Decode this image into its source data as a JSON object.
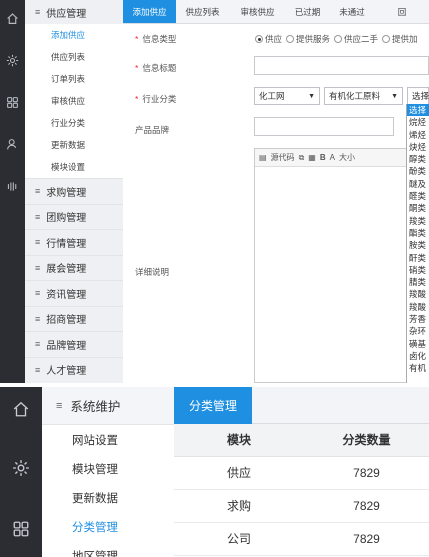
{
  "top": {
    "menu": {
      "title": "供应管理",
      "items": [
        {
          "label": "添加供应",
          "active": true
        },
        {
          "label": "供应列表"
        },
        {
          "label": "订单列表"
        },
        {
          "label": "审核供应"
        },
        {
          "label": "行业分类"
        },
        {
          "label": "更新数据"
        },
        {
          "label": "模块设置"
        }
      ],
      "groups": [
        "求购管理",
        "团购管理",
        "行情管理",
        "展会管理",
        "资讯管理",
        "招商管理",
        "品牌管理",
        "人才管理"
      ]
    },
    "tabs": [
      {
        "label": "添加供应",
        "active": true
      },
      {
        "label": "供应列表"
      },
      {
        "label": "审核供应"
      },
      {
        "label": "已过期"
      },
      {
        "label": "未通过"
      },
      {
        "label": "回"
      }
    ],
    "form": {
      "type_label": "信息类型",
      "type_options": [
        "供应",
        "提供服务",
        "供应二手",
        "提供加"
      ],
      "title_label": "信息标题",
      "category_label": "行业分类",
      "category_selects": [
        "化工网",
        "有机化工原料",
        "选择"
      ],
      "brand_label": "产品品牌",
      "detail_label": "详细说明",
      "editor_toolbar": [
        "源代码",
        "B",
        "大小"
      ]
    },
    "dropdown": [
      "选择",
      "烷烃",
      "烯烃",
      "炔烃",
      "醇类",
      "酚类",
      "醚及",
      "醛类",
      "酮类",
      "羧类",
      "酯类",
      "胺类",
      "酐类",
      "硝类",
      "腈类",
      "羧酸",
      "羧酸",
      "芳香",
      "杂环",
      "磺基",
      "卤化",
      "有机"
    ]
  },
  "bottom": {
    "menu": {
      "title": "系统维护",
      "items": [
        {
          "label": "网站设置"
        },
        {
          "label": "模块管理"
        },
        {
          "label": "更新数据"
        },
        {
          "label": "分类管理",
          "active": true
        },
        {
          "label": "地区管理"
        }
      ]
    },
    "tab": "分类管理",
    "table": {
      "headers": [
        "模块",
        "分类数量"
      ],
      "rows": [
        [
          "供应",
          "7829"
        ],
        [
          "求购",
          "7829"
        ],
        [
          "公司",
          "7829"
        ]
      ]
    }
  },
  "colors": {
    "accent": "#1e8fe1",
    "rail": "#2b2d33",
    "required": "#ee2233"
  },
  "icons": [
    "home-icon",
    "gear-icon",
    "grid-icon",
    "user-icon",
    "bars-icon"
  ]
}
